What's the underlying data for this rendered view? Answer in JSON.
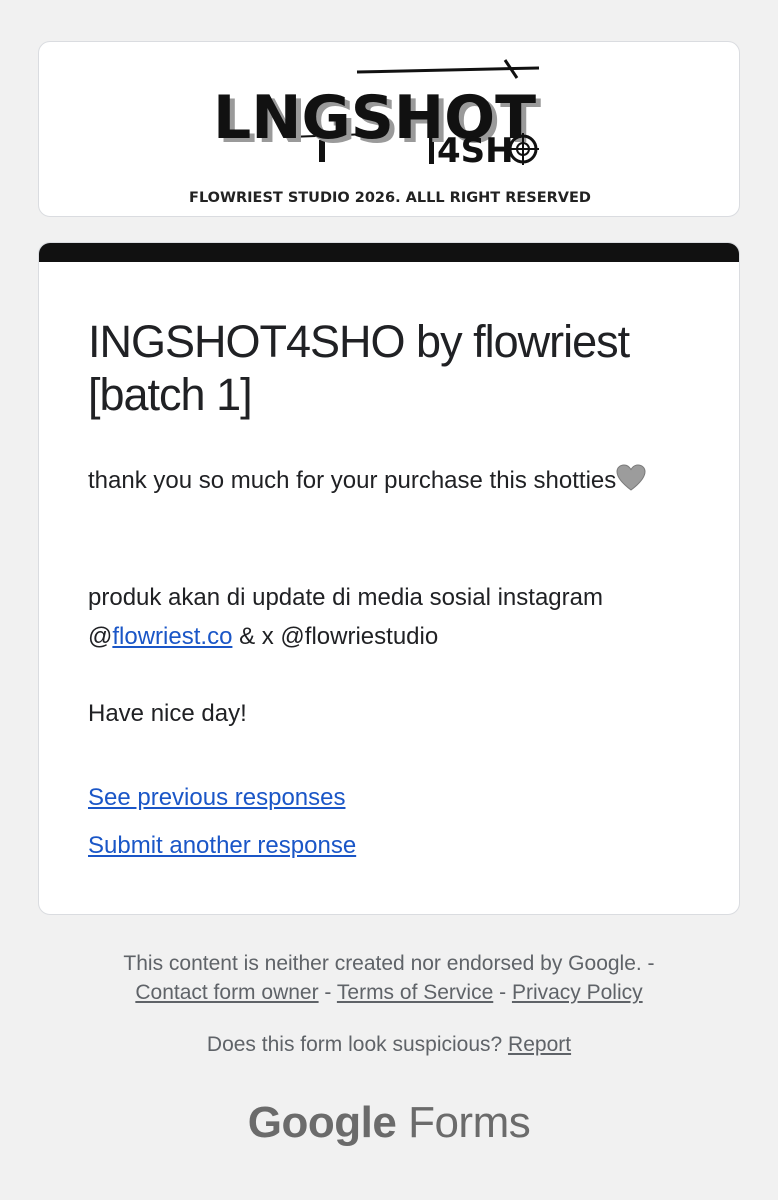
{
  "header": {
    "logo_text_main": "LNGSHOT",
    "logo_text_sub": "4SH",
    "banner_caption": "FLOWRIEST STUDIO 2026. ALLL RIGHT RESERVED"
  },
  "form": {
    "title": "INGSHOT4SHO by flowriest [batch 1]",
    "message_line1": "thank you so much for your purchase this shotties",
    "message_line2_prefix": "produk akan di update di media sosial instagram @",
    "message_link": "flowriest.co",
    "message_line2_suffix": " & x @flowriestudio",
    "message_line3": "Have nice day!",
    "see_previous_label": "See previous responses",
    "submit_another_label": "Submit another response",
    "accent_color": "#111111",
    "link_color": "#1a56c7"
  },
  "footer": {
    "disclaimer": "This content is neither created nor endorsed by Google. -",
    "contact_owner": "Contact form owner",
    "sep1": " - ",
    "terms": "Terms of Service",
    "sep2": " - ",
    "privacy": "Privacy Policy",
    "suspicious_text": "Does this form look suspicious?",
    "report": "Report",
    "brand_google": "Google",
    "brand_forms": "Forms"
  }
}
